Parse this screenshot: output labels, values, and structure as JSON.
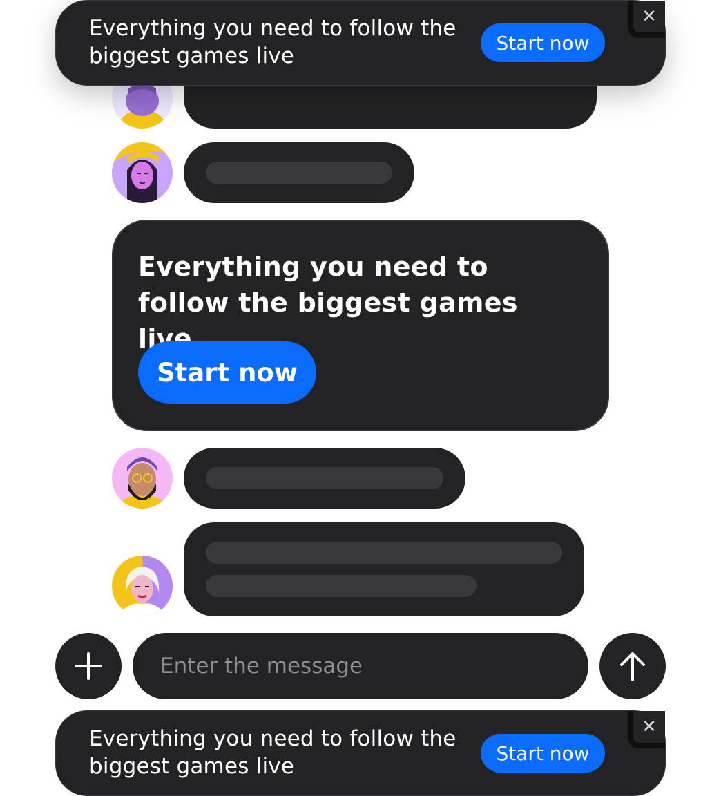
{
  "top_banner": {
    "text": "Everything you need to follow the biggest games live",
    "button_label": "Start now",
    "close_glyph": "✕"
  },
  "card": {
    "text": "Everything you need to follow the biggest games live",
    "button_label": "Start now"
  },
  "composer": {
    "placeholder": "Enter the message",
    "add_icon": "plus-icon",
    "send_icon": "arrow-up-icon"
  },
  "bottom_banner": {
    "text": "Everything you need to follow the biggest games live",
    "button_label": "Start now",
    "close_glyph": "✕"
  },
  "colors": {
    "accent": "#0a6cff",
    "surface": "#232325",
    "placeholder_bar": "#39393c"
  }
}
